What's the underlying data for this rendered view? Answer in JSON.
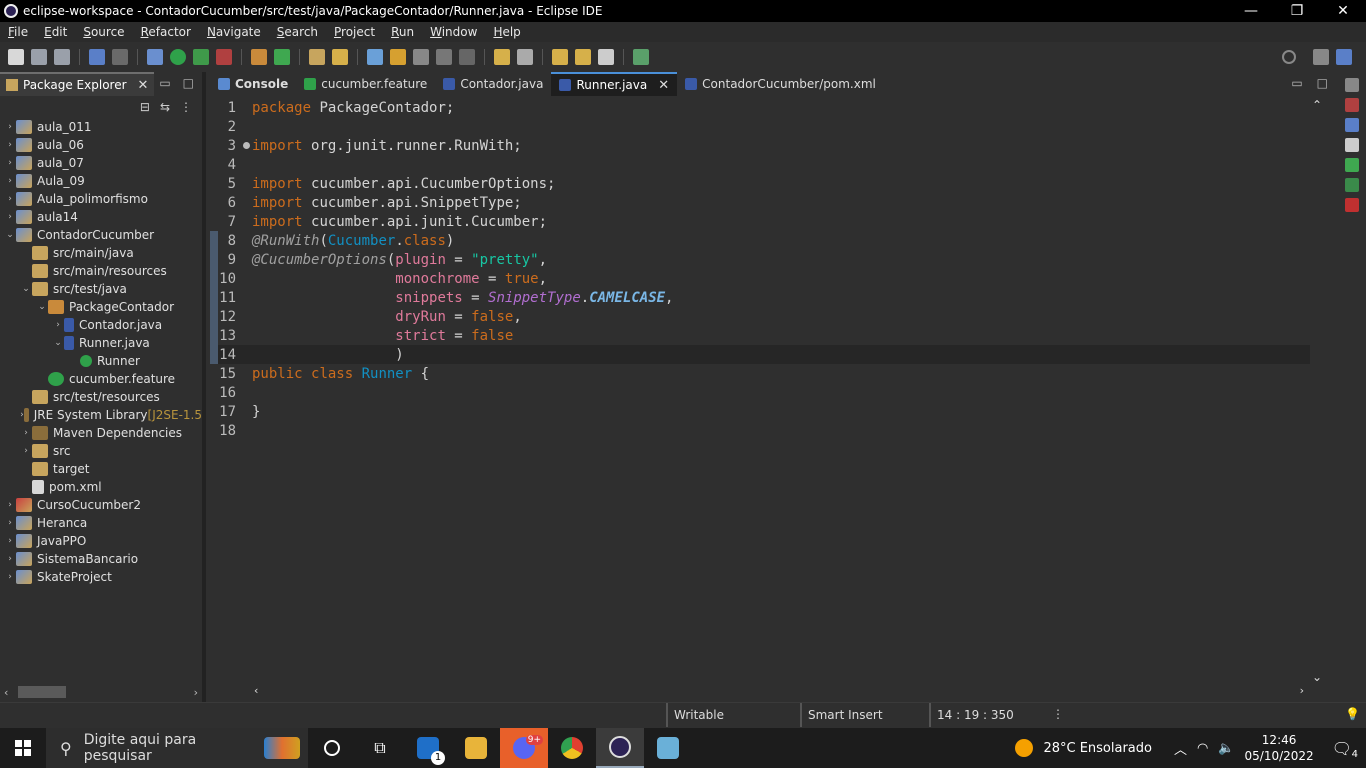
{
  "window": {
    "title": "eclipse-workspace - ContadorCucumber/src/test/java/PackageContador/Runner.java - Eclipse IDE",
    "minimize": "—",
    "restore": "❐",
    "close": "✕"
  },
  "menu": [
    "File",
    "Edit",
    "Source",
    "Refactor",
    "Navigate",
    "Search",
    "Project",
    "Run",
    "Window",
    "Help"
  ],
  "package_explorer": {
    "tab_label": "Package Explorer",
    "tree": [
      {
        "label": "aula_011",
        "level": 0,
        "arrow": "›",
        "icon": "proj"
      },
      {
        "label": "aula_06",
        "level": 0,
        "arrow": "›",
        "icon": "proj"
      },
      {
        "label": "aula_07",
        "level": 0,
        "arrow": "›",
        "icon": "proj"
      },
      {
        "label": "Aula_09",
        "level": 0,
        "arrow": "›",
        "icon": "proj"
      },
      {
        "label": "Aula_polimorfismo",
        "level": 0,
        "arrow": "›",
        "icon": "proj"
      },
      {
        "label": "aula14",
        "level": 0,
        "arrow": "›",
        "icon": "proj"
      },
      {
        "label": "ContadorCucumber",
        "level": 0,
        "arrow": "⌄",
        "icon": "proj"
      },
      {
        "label": "src/main/java",
        "level": 1,
        "arrow": "",
        "icon": "folder"
      },
      {
        "label": "src/main/resources",
        "level": 1,
        "arrow": "",
        "icon": "folder"
      },
      {
        "label": "src/test/java",
        "level": 1,
        "arrow": "⌄",
        "icon": "folder"
      },
      {
        "label": "PackageContador",
        "level": 2,
        "arrow": "⌄",
        "icon": "pkg"
      },
      {
        "label": "Contador.java",
        "level": 3,
        "arrow": "›",
        "icon": "java"
      },
      {
        "label": "Runner.java",
        "level": 3,
        "arrow": "⌄",
        "icon": "java"
      },
      {
        "label": "Runner",
        "level": 4,
        "arrow": "",
        "icon": "cls"
      },
      {
        "label": "cucumber.feature",
        "level": 2,
        "arrow": "",
        "icon": "feat"
      },
      {
        "label": "src/test/resources",
        "level": 1,
        "arrow": "",
        "icon": "folder"
      },
      {
        "label": "JRE System Library",
        "deco": " [J2SE-1.5",
        "level": 1,
        "arrow": "›",
        "icon": "lib"
      },
      {
        "label": "Maven Dependencies",
        "level": 1,
        "arrow": "›",
        "icon": "lib"
      },
      {
        "label": "src",
        "level": 1,
        "arrow": "›",
        "icon": "folder"
      },
      {
        "label": "target",
        "level": 1,
        "arrow": "",
        "icon": "folder"
      },
      {
        "label": "pom.xml",
        "level": 1,
        "arrow": "",
        "icon": "xml"
      },
      {
        "label": "CursoCucumber2",
        "level": 0,
        "arrow": "›",
        "icon": "proj-err"
      },
      {
        "label": "Heranca",
        "level": 0,
        "arrow": "›",
        "icon": "proj"
      },
      {
        "label": "JavaPPO",
        "level": 0,
        "arrow": "›",
        "icon": "proj"
      },
      {
        "label": "SistemaBancario",
        "level": 0,
        "arrow": "›",
        "icon": "proj"
      },
      {
        "label": "SkateProject",
        "level": 0,
        "arrow": "›",
        "icon": "proj"
      }
    ]
  },
  "editor_tabs": [
    {
      "label": "Console",
      "active": false,
      "bold": true,
      "icon_color": "#5a8ad0"
    },
    {
      "label": "cucumber.feature",
      "active": false,
      "icon_color": "#2fa14a"
    },
    {
      "label": "Contador.java",
      "active": false,
      "icon_color": "#3a5aa8"
    },
    {
      "label": "Runner.java",
      "active": true,
      "icon_color": "#3a5aa8",
      "closable": true
    },
    {
      "label": "ContadorCucumber/pom.xml",
      "active": false,
      "icon_color": "#3a5aa8"
    }
  ],
  "code_lines": [
    [
      {
        "t": "package ",
        "c": "kw"
      },
      {
        "t": "PackageContador;",
        "c": "code"
      }
    ],
    [],
    [
      {
        "t": "import ",
        "c": "kw"
      },
      {
        "t": "org.junit.runner.RunWith;",
        "c": "code"
      }
    ],
    [],
    [
      {
        "t": "import ",
        "c": "kw"
      },
      {
        "t": "cucumber.api.CucumberOptions;",
        "c": "code"
      }
    ],
    [
      {
        "t": "import ",
        "c": "kw"
      },
      {
        "t": "cucumber.api.SnippetType;",
        "c": "code"
      }
    ],
    [
      {
        "t": "import ",
        "c": "kw"
      },
      {
        "t": "cucumber.api.junit.Cucumber;",
        "c": "code"
      }
    ],
    [
      {
        "t": "@RunWith",
        "c": "ann"
      },
      {
        "t": "(",
        "c": "code"
      },
      {
        "t": "Cucumber",
        "c": "cls"
      },
      {
        "t": ".",
        "c": "code"
      },
      {
        "t": "class",
        "c": "kw"
      },
      {
        "t": ")",
        "c": "code"
      }
    ],
    [
      {
        "t": "@CucumberOptions",
        "c": "ann"
      },
      {
        "t": "(",
        "c": "code"
      },
      {
        "t": "plugin",
        "c": "field"
      },
      {
        "t": " = ",
        "c": "code"
      },
      {
        "t": "\"pretty\"",
        "c": "str"
      },
      {
        "t": ",",
        "c": "code"
      }
    ],
    [
      {
        "t": "                 ",
        "c": "code"
      },
      {
        "t": "monochrome",
        "c": "field"
      },
      {
        "t": " = ",
        "c": "code"
      },
      {
        "t": "true",
        "c": "kw"
      },
      {
        "t": ",",
        "c": "code"
      }
    ],
    [
      {
        "t": "                 ",
        "c": "code"
      },
      {
        "t": "snippets",
        "c": "field"
      },
      {
        "t": " = ",
        "c": "code"
      },
      {
        "t": "SnippetType",
        "c": "ital"
      },
      {
        "t": ".",
        "c": "code"
      },
      {
        "t": "CAMELCASE",
        "c": "boldital"
      },
      {
        "t": ",",
        "c": "code"
      }
    ],
    [
      {
        "t": "                 ",
        "c": "code"
      },
      {
        "t": "dryRun",
        "c": "field"
      },
      {
        "t": " = ",
        "c": "code"
      },
      {
        "t": "false",
        "c": "kw"
      },
      {
        "t": ",",
        "c": "code"
      }
    ],
    [
      {
        "t": "                 ",
        "c": "code"
      },
      {
        "t": "strict",
        "c": "field"
      },
      {
        "t": " = ",
        "c": "code"
      },
      {
        "t": "false",
        "c": "kw"
      }
    ],
    [
      {
        "t": "                 )",
        "c": "code"
      }
    ],
    [
      {
        "t": "public ",
        "c": "kw"
      },
      {
        "t": "class ",
        "c": "kw"
      },
      {
        "t": "Runner",
        "c": "cls"
      },
      {
        "t": " {",
        "c": "code"
      }
    ],
    [],
    [
      {
        "t": "}",
        "c": "code"
      }
    ],
    []
  ],
  "code_meta": {
    "current_line": 14,
    "fold_marker_line": 3,
    "changed_lines": [
      8,
      9,
      10,
      11,
      12,
      13,
      14
    ]
  },
  "status": {
    "writable": "Writable",
    "insert_mode": "Smart Insert",
    "position": "14 : 19 : 350"
  },
  "taskbar": {
    "search_placeholder": "Digite aqui para pesquisar",
    "weather": "28°C  Ensolarado",
    "time": "12:46",
    "date": "05/10/2022",
    "notifications": "4",
    "mail_badge": "1",
    "discord_badge": "9+"
  }
}
